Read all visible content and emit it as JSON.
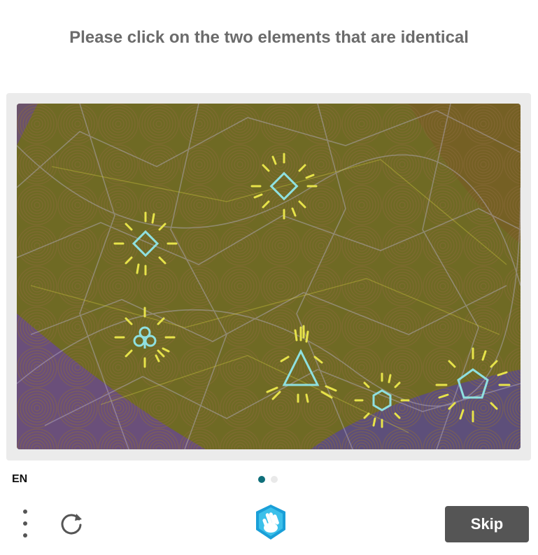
{
  "prompt": "Please click on the two elements that are identical",
  "footer": {
    "language": "EN",
    "skip_label": "Skip",
    "pagination": {
      "total": 2,
      "active": 1
    }
  },
  "icons": {
    "menu": "vertical-dots-icon",
    "refresh": "refresh-icon",
    "logo": "hand-shield-logo"
  },
  "colors": {
    "background_olive": "#6f6a24",
    "accent_teal": "#0f6f7a",
    "skip_button": "#555555",
    "prompt_text": "#6b6b6b"
  },
  "challenge_items": [
    {
      "name": "diamond-shape-top"
    },
    {
      "name": "diamond-shape-left"
    },
    {
      "name": "club-shape"
    },
    {
      "name": "triangle-shape"
    },
    {
      "name": "hexagon-shape"
    },
    {
      "name": "pentagon-shape"
    }
  ]
}
